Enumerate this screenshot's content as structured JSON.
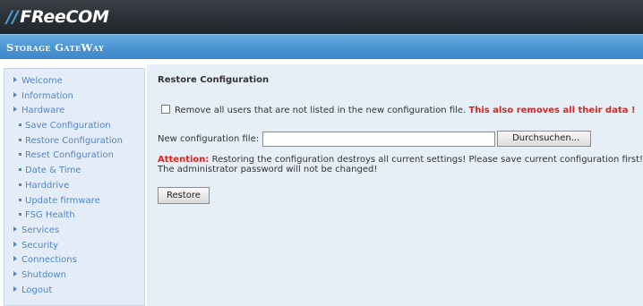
{
  "header": {
    "logo_slashes": "//",
    "logo_text": "FReeCOM",
    "subtitle": "Storage GateWay"
  },
  "sidebar": {
    "items": [
      {
        "label": "Welcome",
        "level": "top"
      },
      {
        "label": "Information",
        "level": "top"
      },
      {
        "label": "Hardware",
        "level": "top"
      },
      {
        "label": "Save Configuration",
        "level": "sub"
      },
      {
        "label": "Restore Configuration",
        "level": "sub"
      },
      {
        "label": "Reset Configuration",
        "level": "sub"
      },
      {
        "label": "Date & Time",
        "level": "sub"
      },
      {
        "label": "Harddrive",
        "level": "sub"
      },
      {
        "label": "Update firmware",
        "level": "sub"
      },
      {
        "label": "FSG Health",
        "level": "sub"
      },
      {
        "label": "Services",
        "level": "top"
      },
      {
        "label": "Security",
        "level": "top"
      },
      {
        "label": "Connections",
        "level": "top"
      },
      {
        "label": "Shutdown",
        "level": "top"
      },
      {
        "label": "Logout",
        "level": "top"
      }
    ]
  },
  "main": {
    "heading": "Restore Configuration",
    "checkbox": {
      "checked": false,
      "label": "Remove all users that are not listed in the new configuration file.",
      "warning": "This also removes all their data !"
    },
    "file": {
      "label": "New configuration file:",
      "value": "",
      "browse_label": "Durchsuchen..."
    },
    "attention": {
      "label": "Attention:",
      "line1": "Restoring the configuration destroys all current settings! Please save current configuration first!",
      "line2": "The administrator password will not be changed!"
    },
    "restore_label": "Restore"
  },
  "colors": {
    "topbar": "#2a2e34",
    "subbar": "#4a93d1",
    "link": "#4f86c6",
    "warning": "#e2231a",
    "content_bg": "#e6eef8"
  }
}
